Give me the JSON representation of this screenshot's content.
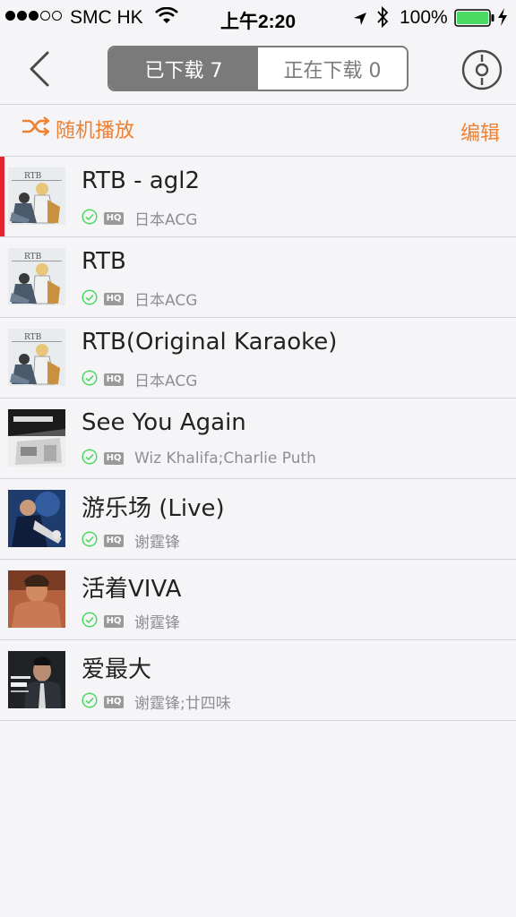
{
  "status_bar": {
    "carrier": "SMC HK",
    "time": "上午2:20",
    "battery_percent": "100%",
    "signal_bars_full": 3,
    "signal_bars_total": 5
  },
  "nav": {
    "tabs": [
      {
        "label": "已下载 7",
        "active": true
      },
      {
        "label": "正在下载 0",
        "active": false
      }
    ]
  },
  "actions": {
    "shuffle_label": "随机播放",
    "edit_label": "编辑"
  },
  "colors": {
    "accent": "#f07f30",
    "now_playing": "#e3232d",
    "downloaded": "#4cd964"
  },
  "songs": [
    {
      "title": "RTB - agl2",
      "badge": "HQ",
      "artist": "日本ACG",
      "cover": "anime",
      "playing": true
    },
    {
      "title": "RTB",
      "badge": "HQ",
      "artist": "日本ACG",
      "cover": "anime",
      "playing": false
    },
    {
      "title": "RTB(Original Karaoke)",
      "badge": "HQ",
      "artist": "日本ACG",
      "cover": "anime",
      "playing": false
    },
    {
      "title": "See You Again",
      "badge": "HQ",
      "artist": "Wiz Khalifa;Charlie Puth",
      "cover": "furious",
      "playing": false
    },
    {
      "title": "游乐场 (Live)",
      "badge": "HQ",
      "artist": "谢霆锋",
      "cover": "live",
      "playing": false
    },
    {
      "title": "活着VIVA",
      "badge": "HQ",
      "artist": "谢霆锋",
      "cover": "viva",
      "playing": false
    },
    {
      "title": "爱最大",
      "badge": "HQ",
      "artist": "谢霆锋;廿四味",
      "cover": "love",
      "playing": false
    }
  ]
}
